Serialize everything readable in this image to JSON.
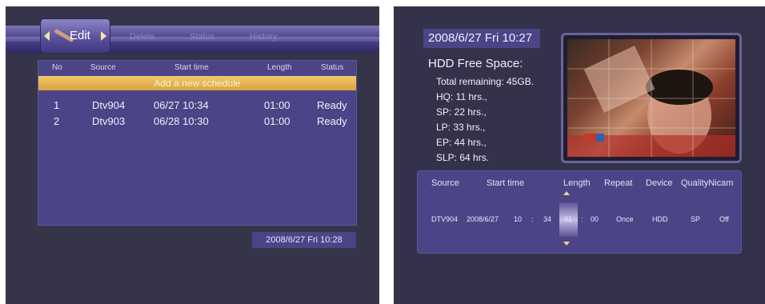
{
  "left": {
    "menu": {
      "active": "Edit",
      "items": [
        "Delete",
        "Status",
        "History"
      ]
    },
    "table": {
      "headers": [
        "No",
        "Source",
        "Start time",
        "Length",
        "Status"
      ],
      "add_row": "Add a new schedule",
      "rows": [
        {
          "no": "1",
          "source": "Dtv904",
          "start": "06/27 10:34",
          "length": "01:00",
          "status": "Ready"
        },
        {
          "no": "2",
          "source": "Dtv903",
          "start": "06/28 10:30",
          "length": "01:00",
          "status": "Ready"
        }
      ]
    },
    "datetime": "2008/6/27 Fri 10:28"
  },
  "right": {
    "datetime": "2008/6/27 Fri 10:27",
    "hdd": {
      "title": "HDD Free Space:",
      "lines": [
        "Total remaining: 45GB.",
        "HQ: 11 hrs.,",
        "SP: 22 hrs.,",
        "LP: 33 hrs.,",
        "EP: 44 hrs.,",
        "SLP: 64 hrs."
      ]
    },
    "schedule": {
      "headers": {
        "source": "Source",
        "start": "Start time",
        "length": "Length",
        "repeat": "Repeat",
        "device": "Device",
        "quality_nicam": "QualityNicam"
      },
      "values": {
        "source": "DTV904",
        "date": "2008/6/27",
        "hour": "10",
        "sep1": ":",
        "minute": "34",
        "len_h": "01",
        "sep2": ":",
        "len_m": "00",
        "repeat": "Once",
        "device": "HDD",
        "quality": "SP",
        "nicam": "Off"
      }
    }
  }
}
